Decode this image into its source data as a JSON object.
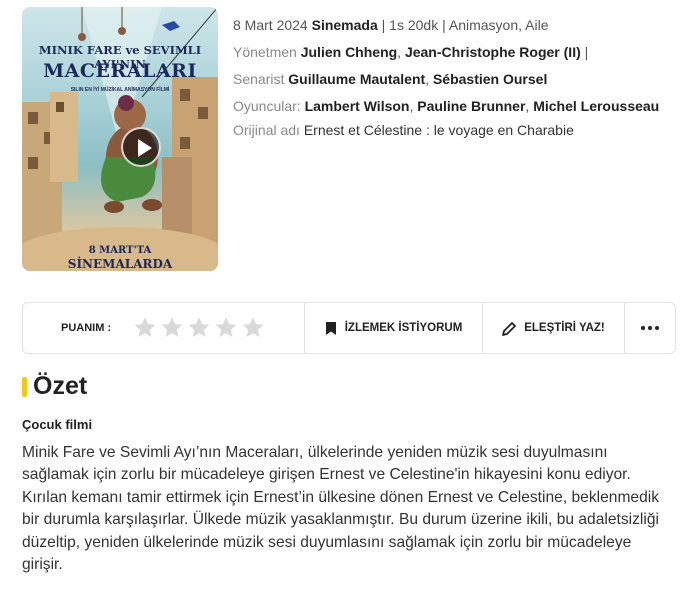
{
  "poster": {
    "title_line1": "MINIK FARE ve SEVIMLI AYI'NIN",
    "title_line2": "MACERALARI",
    "tagline": "SILIN EN İYİ MÜZİKAL ANİMASYON FİLMİ",
    "date_line1": "8 MART'TA",
    "date_line2": "SİNEMALARDA"
  },
  "info": {
    "release_date": "8 Mart 2024",
    "release_where": "Sinemada",
    "duration": "1s 20dk",
    "genres": "Animasyon, Aile",
    "director_label": "Yönetmen",
    "directors": [
      "Julien Chheng",
      "Jean-Christophe Roger (II)"
    ],
    "writer_label": "Senarist",
    "writers": [
      "Guillaume Mautalent",
      "Sébastien Oursel"
    ],
    "cast_label": "Oyuncular:",
    "cast": [
      "Lambert Wilson",
      "Pauline Brunner",
      "Michel Lerousseau"
    ],
    "original_label": "Orijinal adı",
    "original_title": "Ernest et Célestine : le voyage en Charabie"
  },
  "actions": {
    "rating_label": "PUANIM :",
    "rating_value": 0,
    "rating_max": 5,
    "watchlist_label": "İZLEMEK İSTİYORUM",
    "review_label": "ELEŞTİRİ YAZ!"
  },
  "summary": {
    "heading": "Özet",
    "genre_note": "Çocuk filmi",
    "text": "Minik Fare ve Sevimli Ayı’nın Maceraları, ülkelerinde yeniden müzik sesi duyulmasını sağlamak için zorlu bir mücadeleye girişen Ernest ve Celestine'in hikayesini konu ediyor. Kırılan kemanı tamir ettirmek için Ernest’in ülkesine dönen Ernest ve Celestine, beklenmedik bir durumla karşılaşırlar. Ülkede müzik yasaklanmıştır. Bu durum üzerine ikili, bu adaletsizliği düzeltip, yeniden ülkelerinde müzik sesi duyumlasını sağlamak için zorlu bir mücadeleye girişir."
  },
  "colors": {
    "accent": "#f5c518",
    "star_empty": "#d9d9d9"
  }
}
